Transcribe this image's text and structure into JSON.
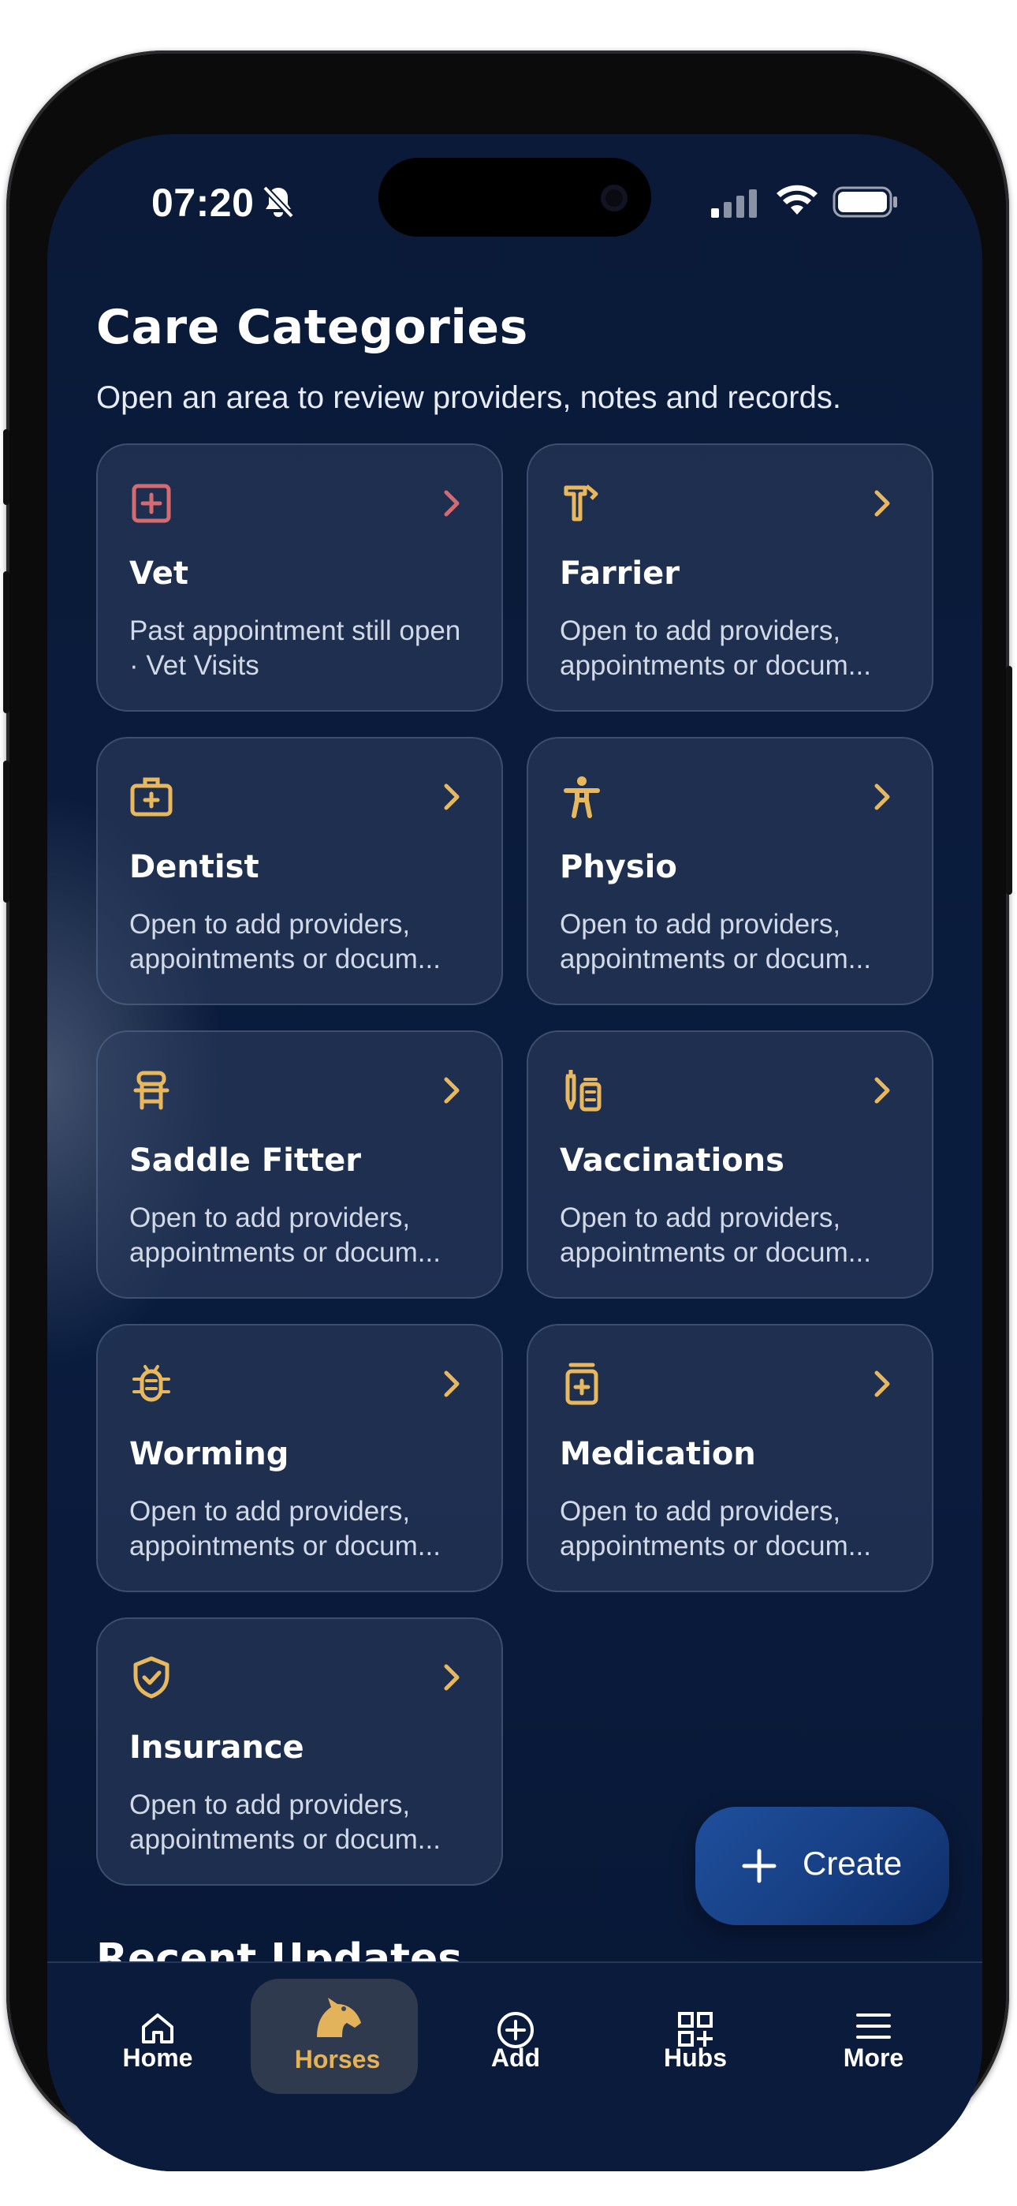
{
  "status_bar": {
    "time": "07:20"
  },
  "header": {
    "title": "Care Categories",
    "subtitle": "Open an area to review providers, notes and records."
  },
  "categories": [
    {
      "name": "Vet",
      "description": "Past appointment still open · Vet Visits",
      "icon": "medical-cross-icon",
      "accent": "#d46a72"
    },
    {
      "name": "Farrier",
      "description": "Open to add providers, appointments or docum...",
      "icon": "hammer-icon",
      "accent": "#e8b85f"
    },
    {
      "name": "Dentist",
      "description": "Open to add providers, appointments or docum...",
      "icon": "medical-kit-icon",
      "accent": "#e8b85f"
    },
    {
      "name": "Physio",
      "description": "Open to add providers, appointments or docum...",
      "icon": "person-icon",
      "accent": "#e8b85f"
    },
    {
      "name": "Saddle Fitter",
      "description": "Open to add providers, appointments or docum...",
      "icon": "saddle-icon",
      "accent": "#e8b85f"
    },
    {
      "name": "Vaccinations",
      "description": "Open to add providers, appointments or docum...",
      "icon": "vaccine-icon",
      "accent": "#e8b85f"
    },
    {
      "name": "Worming",
      "description": "Open to add providers, appointments or docum...",
      "icon": "bug-icon",
      "accent": "#e8b85f"
    },
    {
      "name": "Medication",
      "description": "Open to add providers, appointments or docum...",
      "icon": "medication-bottle-icon",
      "accent": "#e8b85f"
    },
    {
      "name": "Insurance",
      "description": "Open to add providers, appointments or docum...",
      "icon": "shield-check-icon",
      "accent": "#e8b85f"
    }
  ],
  "recent_updates_heading": "Recent Updates",
  "fab": {
    "label": "Create"
  },
  "tabbar": {
    "active": "Horses",
    "tabs": [
      {
        "label": "Home",
        "icon": "home-icon"
      },
      {
        "label": "Horses",
        "icon": "horse-icon"
      },
      {
        "label": "Add",
        "icon": "add-circle-icon"
      },
      {
        "label": "Hubs",
        "icon": "grid-add-icon"
      },
      {
        "label": "More",
        "icon": "menu-icon"
      }
    ]
  },
  "colors": {
    "background": "#0a1a38",
    "accent_gold": "#e8b85f",
    "vet_accent": "#d46a72",
    "fab": "#1b4690"
  }
}
